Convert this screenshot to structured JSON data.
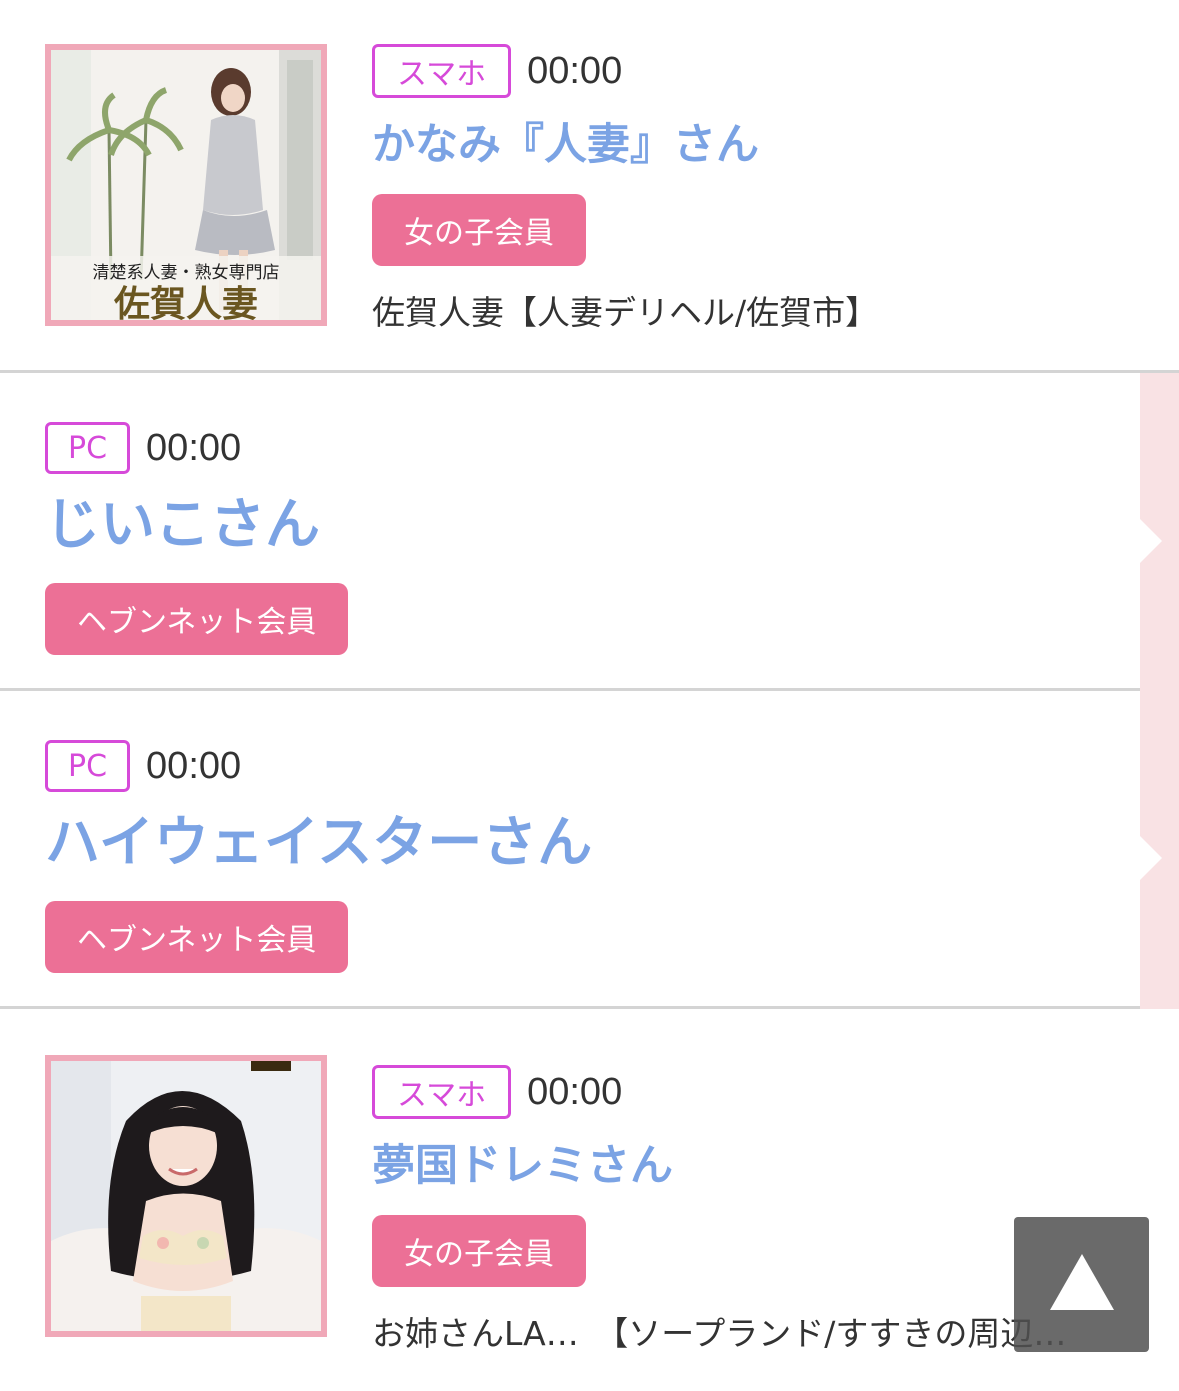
{
  "entries": [
    {
      "device": "スマホ",
      "time": "00:00",
      "name": "かなみ『人妻』さん",
      "badge": "女の子会員",
      "shop": "佐賀人妻【人妻デリヘル/佐賀市】",
      "thumb": {
        "sign_line1": "清楚系人妻・熟女専門店",
        "sign_line2": "佐賀人妻"
      }
    },
    {
      "device": "PC",
      "time": "00:00",
      "name": "じいこさん",
      "badge": "ヘブンネット会員"
    },
    {
      "device": "PC",
      "time": "00:00",
      "name": "ハイウェイスターさん",
      "badge": "ヘブンネット会員"
    },
    {
      "device": "スマホ",
      "time": "00:00",
      "name": "夢国ドレミさん",
      "badge": "女の子会員",
      "shop": "お姉さんLA…　【ソープランド/すすきの周辺…"
    }
  ],
  "colors": {
    "device_border": "#d64ad9",
    "name": "#7ba3e4",
    "badge_bg": "#ec7096",
    "thumb_border": "#f0a8b8",
    "side_strip": "#f9e2e4"
  },
  "icons": {
    "back_to_top": "triangle-up-icon"
  }
}
